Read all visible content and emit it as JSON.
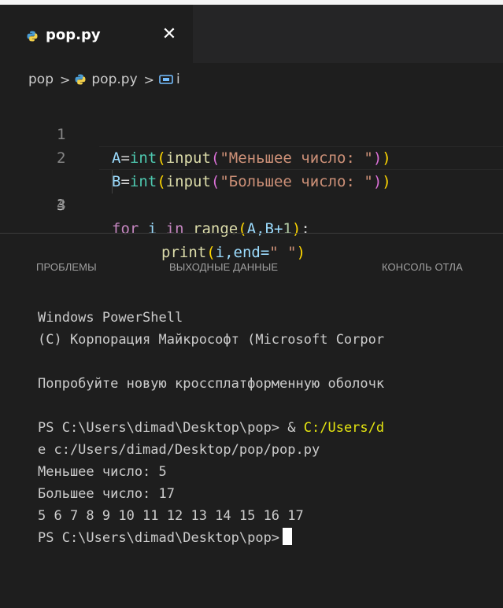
{
  "tab": {
    "label": "pop.py",
    "close_glyph": "✕",
    "icon": "python-file-icon"
  },
  "breadcrumb": {
    "folder": "pop",
    "file": "pop.py",
    "symbol": "i",
    "separator": ">"
  },
  "editor": {
    "lines": [
      {
        "num": "1"
      },
      {
        "num": "2"
      },
      {
        "num": "3"
      },
      {
        "num": "4"
      }
    ],
    "line1": {
      "a": "A",
      "eq": "=",
      "int": "int",
      "p1": "(",
      "input": "input",
      "p2": "(",
      "str": "\"Меньшее число: \"",
      "p3": ")",
      "p4": ")"
    },
    "line2": {
      "a": "B",
      "eq": "=",
      "int": "int",
      "p1": "(",
      "input": "input",
      "p2": "(",
      "str": "\"Большее число: \"",
      "p3": ")",
      "p4": ")"
    },
    "line3": {
      "for": "for",
      "i": " i ",
      "in": "in",
      "sp": " ",
      "range": "range",
      "p1": "(",
      "args": "A,B+",
      "one": "1",
      "p2": ")",
      "colon": ":"
    },
    "line4": {
      "print": "print",
      "p1": "(",
      "args": "i,end=",
      "str": "\" \"",
      "p2": ")"
    }
  },
  "panel": {
    "tabs": [
      "ПРОБЛЕМЫ",
      "ВЫХОДНЫЕ ДАННЫЕ",
      "КОНСОЛЬ ОТЛА"
    ]
  },
  "terminal": {
    "line1": "Windows PowerShell",
    "line2": "(С) Корпорация Майкрософт (Microsoft Corpor",
    "line3": "Попробуйте новую кроссплатформенную оболочк",
    "line4_prompt": "PS C:\\Users\\dimad\\Desktop\\pop> & ",
    "line4_path": "C:/Users/d",
    "line5": "e c:/Users/dimad/Desktop/pop/pop.py",
    "line6": "Меньшее число: 5",
    "line7": "Большее число: 17",
    "line8": "5 6 7 8 9 10 11 12 13 14 15 16 17",
    "line9_prompt": "PS C:\\Users\\dimad\\Desktop\\pop>"
  },
  "colors": {
    "background": "#1e1e1e",
    "keyword": "#c586c0",
    "function": "#dcdcaa",
    "builtin": "#4ec9b0",
    "string": "#ce9178",
    "number": "#b5cea8",
    "terminal_path": "#e5e510"
  }
}
